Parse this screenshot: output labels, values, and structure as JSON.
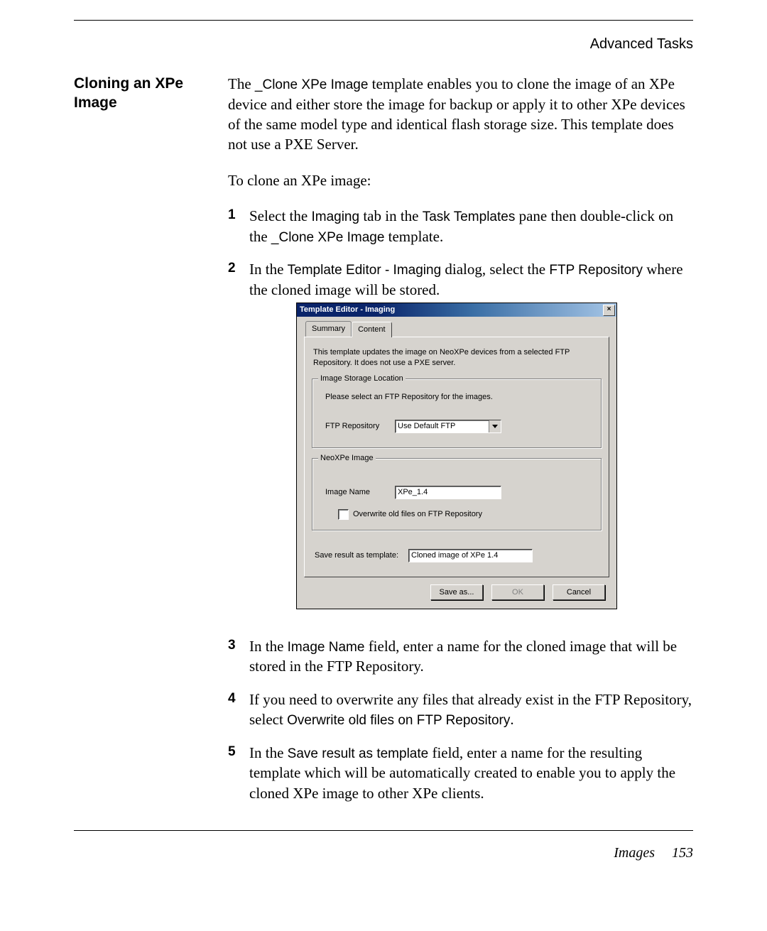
{
  "header": {
    "category": "Advanced Tasks"
  },
  "section_heading": "Cloning an XPe Image",
  "intro": {
    "p1_a": "The ",
    "p1_tpl": "_Clone XPe Image",
    "p1_b": " template enables you to clone the image of an XPe device and either store the image for backup or apply it to other XPe devices of the same model type and identical flash storage size. This template does not use a PXE Server.",
    "p2": "To clone an XPe image:"
  },
  "steps": {
    "n1": "1",
    "s1_a": "Select the ",
    "s1_imaging": "Imaging",
    "s1_b": " tab in the ",
    "s1_tasktpl": "Task Templates",
    "s1_c": " pane then double-click on the ",
    "s1_clone": "_Clone XPe Image",
    "s1_d": " template.",
    "n2": "2",
    "s2_a": "In the ",
    "s2_dlg": "Template Editor - Imaging",
    "s2_b": " dialog, select the ",
    "s2_ftp": "FTP Repository",
    "s2_c": " where the cloned image will be stored.",
    "n3": "3",
    "s3_a": "In the ",
    "s3_field": "Image Name",
    "s3_b": " field, enter a name for the cloned image that will be stored in the FTP Repository.",
    "n4": "4",
    "s4_a": "If you need to overwrite any files that already exist in the FTP Repository, select ",
    "s4_opt": "Overwrite old files on FTP Repository",
    "s4_b": ".",
    "n5": "5",
    "s5_a": "In the ",
    "s5_field": "Save result as template",
    "s5_b": " field, enter a name for the resulting template which will be automatically created to enable you to apply the cloned XPe image to other XPe clients."
  },
  "dialog": {
    "title": "Template Editor - Imaging",
    "close": "×",
    "tabs": {
      "summary": "Summary",
      "content": "Content"
    },
    "description": "This template updates the image on NeoXPe devices from a selected FTP Repository. It does not use a PXE server.",
    "group_storage": {
      "legend": "Image Storage Location",
      "hint": "Please select an FTP Repository for the images.",
      "ftp_label": "FTP Repository",
      "ftp_value": "Use Default FTP"
    },
    "group_image": {
      "legend": "NeoXPe Image",
      "name_label": "Image Name",
      "name_value": "XPe_1.4",
      "overwrite_label": "Overwrite old files on FTP Repository"
    },
    "save_as_template_label": "Save result as template:",
    "save_as_template_value": "Cloned image of XPe 1.4",
    "buttons": {
      "save_as": "Save as...",
      "ok": "OK",
      "cancel": "Cancel"
    }
  },
  "footer": {
    "section": "Images",
    "page": "153"
  }
}
